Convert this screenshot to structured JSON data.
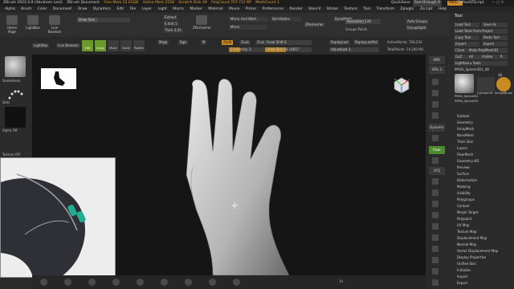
{
  "titlebar": {
    "app": "ZBrush 2022.0.8 [Abraham Leal]",
    "doc": "ZBrush Document",
    "freemem": "Free Mem 22.61GB",
    "activemem": "Active Mem 2558",
    "scratch": "Scratch Disk 49",
    "polycount": "PolyCount 707.712 KP",
    "meshcount": "MeshCount 1",
    "quicksave": "QuickSave",
    "seethrough": "See-through 0",
    "menus": "Menus",
    "defaultscript": "DefaultZScript",
    "winctl": "— ▢ ✕"
  },
  "menubar": [
    "Alpha",
    "Brush",
    "Color",
    "Document",
    "Draw",
    "Dynamics",
    "Edit",
    "File",
    "Layer",
    "Light",
    "Macro",
    "Marker",
    "Material",
    "Movie",
    "Picker",
    "Preferences",
    "Render",
    "Stencil",
    "Stroke",
    "Texture",
    "Tool",
    "Transform",
    "Zplugin",
    "Zscript",
    "Help"
  ],
  "shelf1": {
    "buttons": [
      "Home Page",
      "LightBox",
      "Live Boolean",
      "Edit",
      "Draw",
      "Move",
      "Scale",
      "Rotate"
    ],
    "sliders": [
      {
        "label": "Mrgb",
        "value": ""
      },
      {
        "label": "Rgb",
        "value": ""
      },
      {
        "label": "M",
        "value": ""
      },
      {
        "label": "Zadd",
        "value": ""
      },
      {
        "label": "Zsub",
        "value": ""
      },
      {
        "label": "Zcut",
        "value": ""
      },
      {
        "label": "Rgb Intensity",
        "value": "100"
      },
      {
        "label": "Z Intensity",
        "value": "3"
      },
      {
        "label": "Focal Shift",
        "value": "0"
      },
      {
        "label": "Draw Size",
        "value": "14.14857"
      }
    ],
    "tools": [
      "Extract",
      "E.Smt 5",
      "Thick 0.02",
      "ZRemesher",
      "Mirror And Weld",
      "Mirror",
      "Del Hidden",
      "ZRemesher"
    ],
    "resolution": "Resolution 128",
    "groups": "Groups  Polish",
    "dynamesh": "DynaMesh",
    "autogroups": "Auto Groups",
    "groupsplit": "GroupsSplit",
    "replaylast": "ReplayLast",
    "replaylastrel": "ReplayLastRel",
    "adjustlast": "AdjustLast 1",
    "activepoints": "ActivePoints: 708,234",
    "totalpoints": "TotalPoints: 14.240 Mil"
  },
  "leftshelf": {
    "brush": "SnakeHook",
    "stroke": "Dots",
    "alpha": "Alpha Off",
    "texture": "Texture Off"
  },
  "canvas": {
    "frame_index": "14"
  },
  "righticons": [
    "BPR",
    "SPix 3",
    "Scroll",
    "Zoom",
    "Actual",
    "AAHalf",
    "Dynamic",
    "Persp",
    "Floor",
    "Local",
    "XYZ",
    "Frame",
    "Move",
    "Zoom3D",
    "Rotate",
    "Line Fill",
    "PolyF",
    "Transp",
    "Ghost",
    "Solo",
    "Xpose"
  ],
  "tool": {
    "title": "Tool",
    "buttons": [
      "Load Tool",
      "Save As",
      "Load Tools From Project",
      "Copy Tool",
      "Paste Tool",
      "Import",
      "Export",
      "Clone",
      "Make PolyMesh3D",
      "GoZ",
      "All",
      "Visible",
      "R"
    ],
    "lightbox": "Lightbox ▸ Tools",
    "current": "PM3D_Sphere3D1_48",
    "count": "48",
    "thumbs": [
      "PM3D_Sphere3D",
      "Cylinder3D",
      "SimpleBrush",
      "PM3D_Sphere3D"
    ],
    "subpalettes": [
      "Subtool",
      "Geometry",
      "ArrayMesh",
      "NanoMesh",
      "Thick Skin",
      "Layers",
      "FiberMesh",
      "Geometry HD",
      "Preview",
      "Surface",
      "Deformation",
      "Masking",
      "Visibility",
      "Polygroups",
      "Contact",
      "Morph Target",
      "Polypaint",
      "UV Map",
      "Texture Map",
      "Displacement Map",
      "Normal Map",
      "Vector Displacement Map",
      "Display Properties",
      "Unified Skin",
      "Initialize",
      "Import",
      "Export"
    ]
  },
  "colors": {
    "accent": "#d28a22",
    "active_green": "#4f8a2f",
    "canvas_bg": "#151515",
    "ui_bg": "#2c2c2c"
  }
}
